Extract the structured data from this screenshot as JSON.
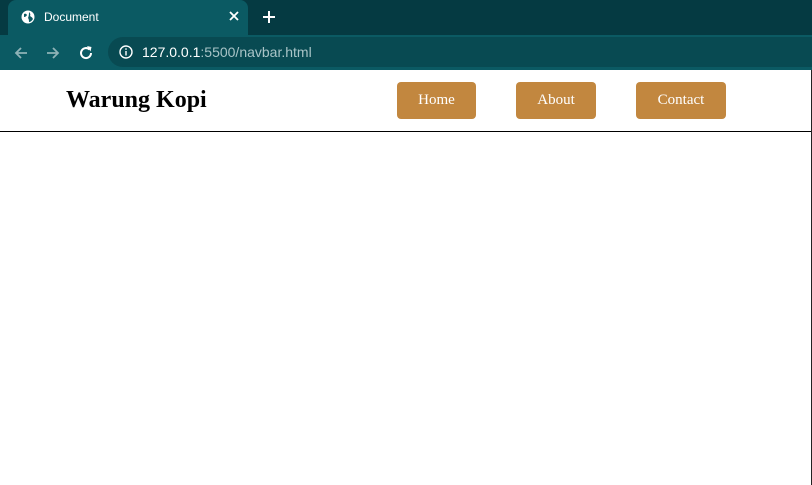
{
  "browser": {
    "tab": {
      "title": "Document",
      "favicon": "globe-icon"
    },
    "address_bar": {
      "host": "127.0.0.1",
      "path": ":5500/navbar.html"
    },
    "colors": {
      "tabstrip": "#053a42",
      "toolbar": "#0b5a63",
      "omnibox": "#084a52"
    }
  },
  "page": {
    "brand": "Warung Kopi",
    "nav": {
      "home": "Home",
      "about": "About",
      "contact": "Contact"
    },
    "colors": {
      "button": "#c2873f",
      "button_text": "#ffffff",
      "border": "#000000"
    }
  }
}
